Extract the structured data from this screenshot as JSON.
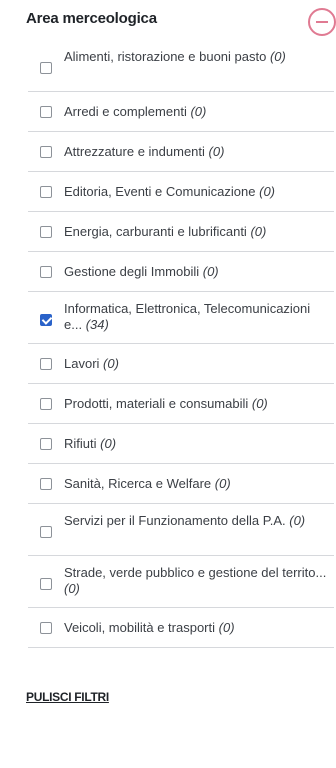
{
  "filter": {
    "title": "Area merceologica",
    "toggle_icon": "minus-circle-icon",
    "accent_color": "#e07a92",
    "check_color": "#2a62c9",
    "items": [
      {
        "label": "Alimenti, ristorazione e buoni pasto",
        "count": "(0)",
        "checked": false
      },
      {
        "label": "Arredi e complementi",
        "count": "(0)",
        "checked": false
      },
      {
        "label": "Attrezzature e indumenti",
        "count": "(0)",
        "checked": false
      },
      {
        "label": "Editoria, Eventi e Comunicazione",
        "count": "(0)",
        "checked": false
      },
      {
        "label": "Energia, carburanti e lubrificanti",
        "count": "(0)",
        "checked": false
      },
      {
        "label": "Gestione degli Immobili",
        "count": "(0)",
        "checked": false
      },
      {
        "label": "Informatica, Elettronica, Telecomunicazioni e...",
        "count": "(34)",
        "checked": true
      },
      {
        "label": "Lavori",
        "count": "(0)",
        "checked": false
      },
      {
        "label": "Prodotti, materiali e consumabili",
        "count": "(0)",
        "checked": false
      },
      {
        "label": "Rifiuti",
        "count": "(0)",
        "checked": false
      },
      {
        "label": "Sanità, Ricerca e Welfare",
        "count": "(0)",
        "checked": false
      },
      {
        "label": "Servizi per il Funzionamento della P.A.",
        "count": "(0)",
        "checked": false
      },
      {
        "label": "Strade, verde pubblico e gestione del territo...",
        "count": "(0)",
        "checked": false
      },
      {
        "label": "Veicoli, mobilità e trasporti",
        "count": "(0)",
        "checked": false
      }
    ],
    "clear_label": "PULISCI FILTRI"
  }
}
